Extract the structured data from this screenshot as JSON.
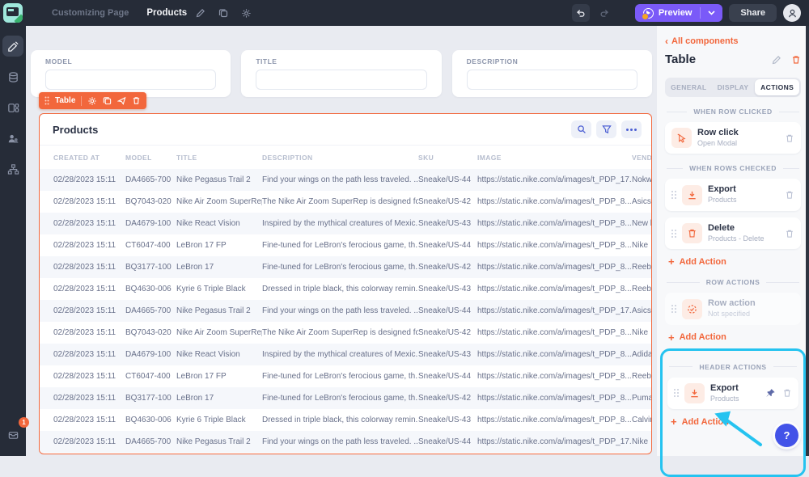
{
  "topbar": {
    "breadcrumb": "Customizing Page",
    "page_name": "Products",
    "preview_label": "Preview",
    "share_label": "Share"
  },
  "sidebar": {
    "badge_count": "1"
  },
  "canvas": {
    "fields": [
      {
        "label": "MODEL"
      },
      {
        "label": "TITLE"
      },
      {
        "label": "DESCRIPTION"
      }
    ],
    "chip": {
      "label": "Table"
    },
    "table": {
      "title": "Products",
      "columns": [
        "CREATED AT",
        "MODEL",
        "TITLE",
        "DESCRIPTION",
        "SKU",
        "IMAGE",
        "VENDOR N"
      ],
      "rows": [
        [
          "02/28/2023 15:11",
          "DA4665-700",
          "Nike Pegasus Trail 2",
          "Find your wings on the path less traveled. ...",
          "Sneake/US-44",
          "https://static.nike.com/a/images/t_PDP_17...",
          "Nokwol"
        ],
        [
          "02/28/2023 15:11",
          "BQ7043-020",
          "Nike Air Zoom SuperRep",
          "The Nike Air Zoom SuperRep is designed fo...",
          "Sneake/US-42",
          "https://static.nike.com/a/images/t_PDP_8...",
          "Asics"
        ],
        [
          "02/28/2023 15:11",
          "DA4679-100",
          "Nike React Vision",
          "Inspired by the mythical creatures of Mexic...",
          "Sneake/US-43",
          "https://static.nike.com/a/images/t_PDP_8...",
          "New ba"
        ],
        [
          "02/28/2023 15:11",
          "CT6047-400",
          "LeBron 17 FP",
          "Fine-tuned for LeBron's ferocious game, th...",
          "Sneake/US-44",
          "https://static.nike.com/a/images/t_PDP_8...",
          "Nike"
        ],
        [
          "02/28/2023 15:11",
          "BQ3177-100",
          "LeBron 17",
          "Fine-tuned for LeBron's ferocious game, th...",
          "Sneake/US-42",
          "https://static.nike.com/a/images/t_PDP_8...",
          "Reebok"
        ],
        [
          "02/28/2023 15:11",
          "BQ4630-006",
          "Kyrie 6 Triple Black",
          "Dressed in triple black, this colorway remin...",
          "Sneake/US-43",
          "https://static.nike.com/a/images/t_PDP_8...",
          "Reebok"
        ],
        [
          "02/28/2023 15:11",
          "DA4665-700",
          "Nike Pegasus Trail 2",
          "Find your wings on the path less traveled. ...",
          "Sneake/US-44",
          "https://static.nike.com/a/images/t_PDP_17...",
          "Asics"
        ],
        [
          "02/28/2023 15:11",
          "BQ7043-020",
          "Nike Air Zoom SuperRep",
          "The Nike Air Zoom SuperRep is designed fo...",
          "Sneake/US-42",
          "https://static.nike.com/a/images/t_PDP_8...",
          "Nike"
        ],
        [
          "02/28/2023 15:11",
          "DA4679-100",
          "Nike React Vision",
          "Inspired by the mythical creatures of Mexic...",
          "Sneake/US-43",
          "https://static.nike.com/a/images/t_PDP_8...",
          "Adidas"
        ],
        [
          "02/28/2023 15:11",
          "CT6047-400",
          "LeBron 17 FP",
          "Fine-tuned for LeBron's ferocious game, th...",
          "Sneake/US-44",
          "https://static.nike.com/a/images/t_PDP_8...",
          "Reebok"
        ],
        [
          "02/28/2023 15:11",
          "BQ3177-100",
          "LeBron 17",
          "Fine-tuned for LeBron's ferocious game, th...",
          "Sneake/US-42",
          "https://static.nike.com/a/images/t_PDP_8...",
          "Puma"
        ],
        [
          "02/28/2023 15:11",
          "BQ4630-006",
          "Kyrie 6 Triple Black",
          "Dressed in triple black, this colorway remin...",
          "Sneake/US-43",
          "https://static.nike.com/a/images/t_PDP_8...",
          "Calvin K"
        ],
        [
          "02/28/2023 15:11",
          "DA4665-700",
          "Nike Pegasus Trail 2",
          "Find your wings on the path less traveled. ...",
          "Sneake/US-44",
          "https://static.nike.com/a/images/t_PDP_17...",
          "Nike"
        ]
      ]
    }
  },
  "panel": {
    "back_label": "All components",
    "title": "Table",
    "tabs": [
      {
        "label": "GENERAL",
        "active": false
      },
      {
        "label": "DISPLAY",
        "active": false
      },
      {
        "label": "ACTIONS",
        "active": true
      }
    ],
    "add_action_label": "Add Action",
    "sections": [
      {
        "heading": "WHEN ROW CLICKED",
        "highlight": false,
        "add_action": false,
        "cards": [
          {
            "icon": "cursor-click-icon",
            "title": "Row click",
            "subtitle": "Open Modal",
            "drag": false,
            "pin": false,
            "trash": true,
            "muted": false
          }
        ]
      },
      {
        "heading": "WHEN ROWS CHECKED",
        "highlight": false,
        "add_action": true,
        "cards": [
          {
            "icon": "download-icon",
            "title": "Export",
            "subtitle": "Products",
            "drag": true,
            "pin": false,
            "trash": true,
            "muted": false
          },
          {
            "icon": "trash-icon",
            "title": "Delete",
            "subtitle": "Products - Delete",
            "drag": true,
            "pin": false,
            "trash": true,
            "muted": false
          }
        ]
      },
      {
        "heading": "ROW ACTIONS",
        "highlight": false,
        "add_action": true,
        "cards": [
          {
            "icon": "check-circle-icon",
            "title": "Row action",
            "subtitle": "Not specified",
            "drag": true,
            "pin": false,
            "trash": false,
            "muted": true
          }
        ]
      },
      {
        "heading": "HEADER ACTIONS",
        "highlight": true,
        "add_action": true,
        "cards": [
          {
            "icon": "download-icon",
            "title": "Export",
            "subtitle": "Products",
            "drag": true,
            "pin": true,
            "trash": true,
            "muted": false
          }
        ]
      }
    ],
    "help_label": "?"
  },
  "colors": {
    "accent_orange": "#f2673c",
    "accent_purple": "#7a5af8",
    "highlight_cyan": "#25c3f0",
    "icon_blue": "#4c5fd3",
    "help_blue": "#4353e8",
    "topbar_bg": "#262c38"
  }
}
